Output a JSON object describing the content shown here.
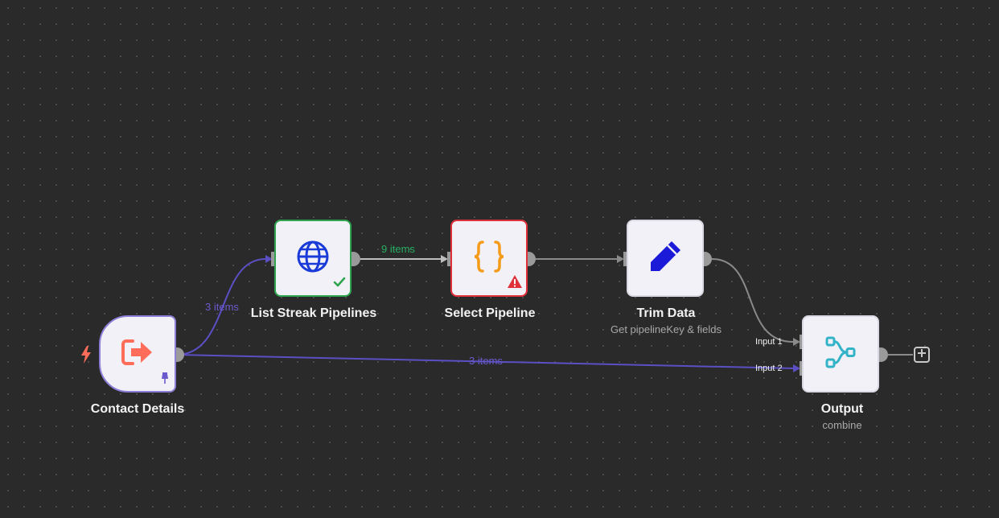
{
  "nodes": {
    "contact_details": {
      "title": "Contact Details",
      "icon": "exit-arrow-icon",
      "pinned": true
    },
    "list_streak_pipelines": {
      "title": "List Streak Pipelines",
      "icon": "globe-icon",
      "status": "success"
    },
    "select_pipeline": {
      "title": "Select Pipeline",
      "icon": "code-braces-icon",
      "status": "error"
    },
    "trim_data": {
      "title": "Trim Data",
      "subtitle": "Get pipelineKey & fields",
      "icon": "pencil-icon"
    },
    "output": {
      "title": "Output",
      "subtitle": "combine",
      "icon": "merge-icon",
      "inputs": [
        "Input 1",
        "Input 2"
      ]
    }
  },
  "edges": {
    "contact_to_list": {
      "label": "3 items",
      "color": "#6a5acd"
    },
    "list_to_select": {
      "label": "9 items",
      "color": "#27ae60"
    },
    "contact_to_output": {
      "label": "3 items",
      "color": "#6a5acd"
    }
  },
  "colors": {
    "canvas": "#2a2a2a",
    "trigger_accent": "#ff6d5a",
    "success": "#2fa44f",
    "error": "#e0303a",
    "connection": "#8a8a8a",
    "active_connection": "#5b4fc4"
  }
}
